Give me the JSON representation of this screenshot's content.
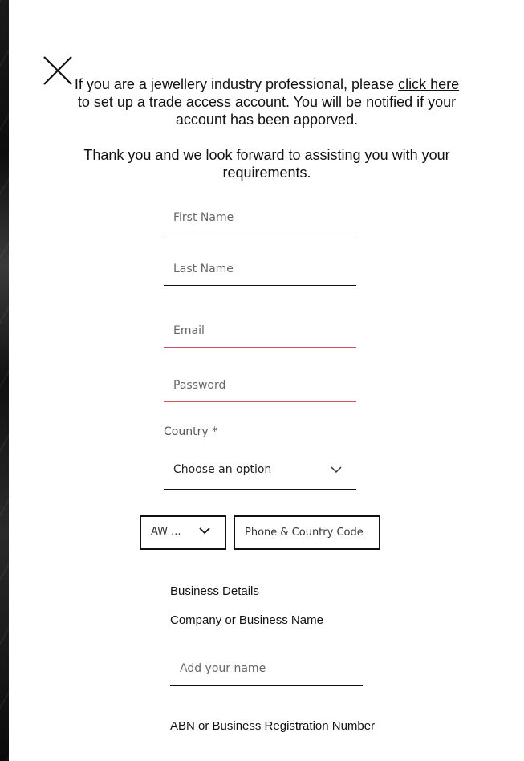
{
  "intro": {
    "line_before_link": "If you are a jewellery industry professional, please ",
    "link_text": "click here",
    "line_after_link": " to set up a trade access account. You will be notified if your account has been apporved.",
    "thanks": "Thank you and we look forward to assisting you with your requirements."
  },
  "form": {
    "first_name_placeholder": "First Name",
    "last_name_placeholder": "Last Name",
    "email_placeholder": "Email",
    "password_placeholder": "Password",
    "country_label": "Country *",
    "country_value": "Choose an option",
    "country_code_value": "AW ...",
    "phone_placeholder": "Phone & Country Code",
    "business_details_heading": "Business Details",
    "company_label": "Company or Business Name",
    "company_placeholder": "Add your name",
    "abn_label": "ABN or Business Registration Number"
  },
  "icons": {
    "close": "close-icon",
    "chevron": "chevron-down-icon"
  },
  "colors": {
    "error_underline": "#d0505a",
    "text": "#111111"
  }
}
